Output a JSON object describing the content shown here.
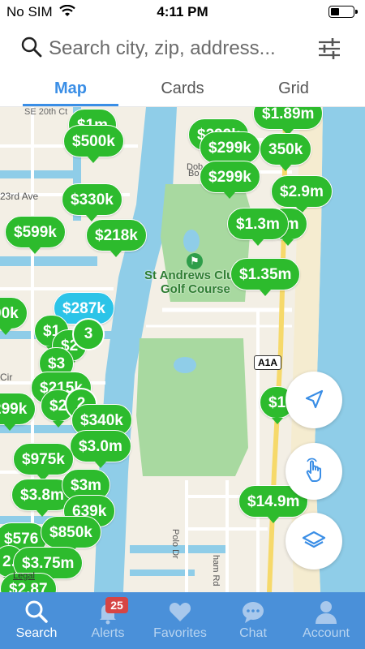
{
  "status_bar": {
    "carrier": "No SIM",
    "time": "4:11 PM"
  },
  "search": {
    "placeholder": "Search city, zip, address..."
  },
  "tabs": [
    {
      "label": "Map",
      "active": true
    },
    {
      "label": "Cards",
      "active": false
    },
    {
      "label": "Grid",
      "active": false
    }
  ],
  "map": {
    "labels": {
      "street_20th": "SE 20th Ct",
      "ave_23rd": "23rd Ave",
      "cir": "Cir",
      "club_line1": "St Andrews Club",
      "club_line2": "Golf Course",
      "road_a1a": "A1A",
      "polo_dr": "Polo Dr",
      "ham_rd": "ham Rd",
      "dob": "Dob",
      "bo": "Bo"
    },
    "pins": {
      "p01": "$1m",
      "p02": "$500k",
      "p03": "$330k",
      "p04": "$218k",
      "p05": "$599k",
      "p06": "$287k",
      "p07": "$1",
      "p08": "$2",
      "p09": "$3",
      "p10": "$215k",
      "p11": "$2",
      "p12": "$340k",
      "p13": "$3.0m",
      "p14": "$975k",
      "p15": "$3.8m",
      "p16": "$3m",
      "p17": "639k",
      "p18": "$850k",
      "p19": "$576",
      "p20": "$3.75m",
      "p21": "$2.87",
      "p22": "299k",
      "p23": "00k",
      "p24": "$1.89m",
      "p25": "$299k",
      "p26": "350k",
      "p27": "$299k",
      "p28": "$2.9m",
      "p29": "$1.3m",
      "p30": "5m",
      "p31": "$1.35m",
      "p32": "$1",
      "p33": "$14.9m",
      "p34": "2."
    },
    "clusters": {
      "c1": "3",
      "c2": "2"
    },
    "legal": "Legal"
  },
  "bottom_nav": [
    {
      "label": "Search",
      "active": true
    },
    {
      "label": "Alerts",
      "active": false,
      "badge": "25"
    },
    {
      "label": "Favorites",
      "active": false
    },
    {
      "label": "Chat",
      "active": false
    },
    {
      "label": "Account",
      "active": false
    }
  ],
  "colors": {
    "accent": "#3a8ee6",
    "pin": "#2dbb2d",
    "pin_selected": "#2cc4e8",
    "nav": "#4a90d9",
    "badge": "#d64545",
    "water": "#8fcde8",
    "park": "#a8d9a0"
  }
}
